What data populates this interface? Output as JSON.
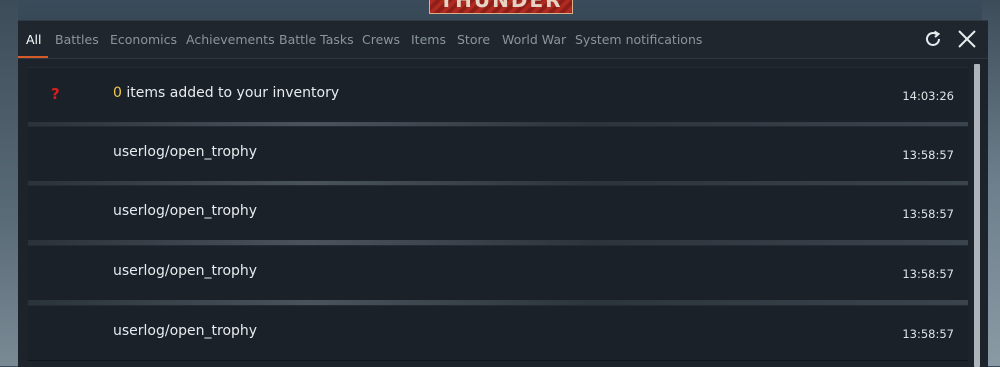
{
  "logo": {
    "text": "THUNDER"
  },
  "tabs": [
    {
      "label": "All",
      "active": true
    },
    {
      "label": "Battles"
    },
    {
      "label": "Economics"
    },
    {
      "label": "Achievements"
    },
    {
      "label": "Battle Tasks"
    },
    {
      "label": "Crews"
    },
    {
      "label": "Items"
    },
    {
      "label": "Store"
    },
    {
      "label": "World War"
    },
    {
      "label": "System notifications"
    }
  ],
  "controls": {
    "refresh_icon": "refresh-icon",
    "close_icon": "close-icon"
  },
  "accent_color": "#d65a28",
  "entries": [
    {
      "icon": "?",
      "count": "0",
      "message": " items  added to your inventory",
      "time": "14:03:26"
    },
    {
      "message": "userlog/open_trophy",
      "time": "13:58:57"
    },
    {
      "message": "userlog/open_trophy",
      "time": "13:58:57"
    },
    {
      "message": "userlog/open_trophy",
      "time": "13:58:57"
    },
    {
      "message": "userlog/open_trophy",
      "time": "13:58:57"
    }
  ]
}
